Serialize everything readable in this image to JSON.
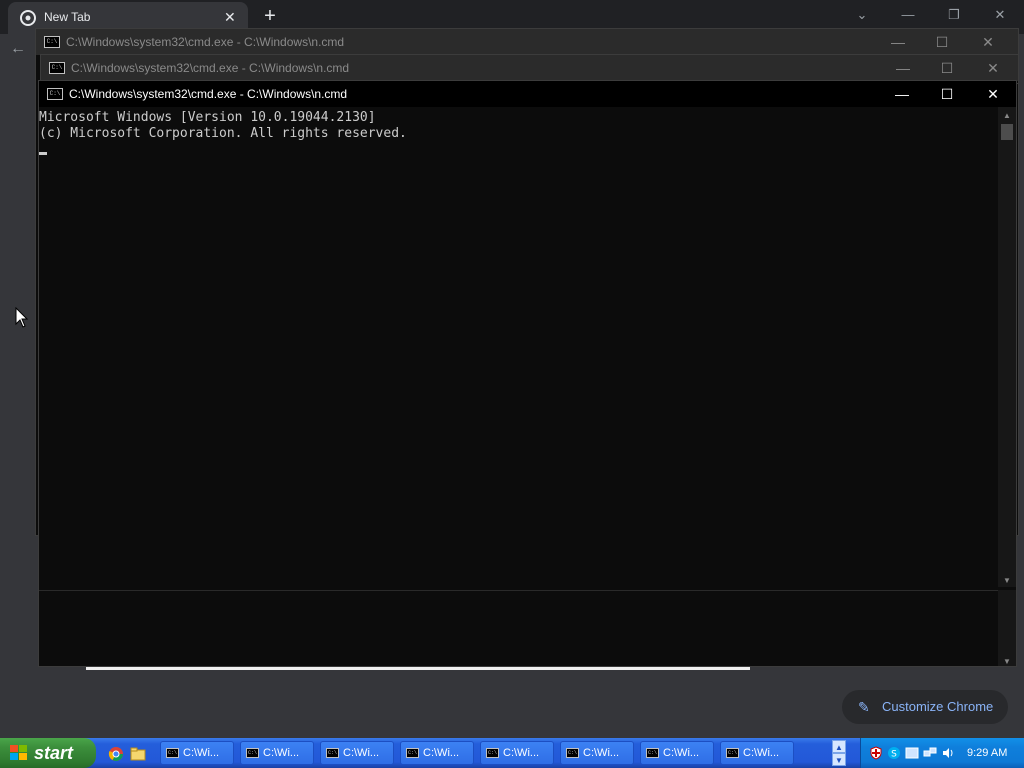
{
  "chrome": {
    "tab_title": "New Tab",
    "tab_close": "✕",
    "new_tab": "+",
    "dropdown_icon": "chevron-down-icon",
    "customize_label": "Customize Chrome"
  },
  "cmd_windows": [
    {
      "title": "C:\\Windows\\system32\\cmd.exe - C:\\Windows\\n.cmd"
    },
    {
      "title": "C:\\Windows\\system32\\cmd.exe - C:\\Windows\\n.cmd"
    },
    {
      "title": "C:\\Windows\\system32\\cmd.exe - C:\\Windows\\n.cmd"
    }
  ],
  "console": {
    "lines": [
      "Microsoft Windows [Version 10.0.19044.2130]",
      "(c) Microsoft Corporation. All rights reserved."
    ]
  },
  "taskbar": {
    "start_label": "start",
    "tasks": [
      {
        "label": "C:\\Wi..."
      },
      {
        "label": "C:\\Wi..."
      },
      {
        "label": "C:\\Wi..."
      },
      {
        "label": "C:\\Wi..."
      },
      {
        "label": "C:\\Wi..."
      },
      {
        "label": "C:\\Wi..."
      },
      {
        "label": "C:\\Wi..."
      },
      {
        "label": "C:\\Wi..."
      }
    ],
    "clock": "9:29 AM"
  },
  "colors": {
    "chrome_bg": "#35363a",
    "console_bg": "#0c0c0c",
    "console_text": "#cccccc",
    "taskbar_blue": "#245edb",
    "start_green": "#3c8f3c",
    "link_blue": "#8ab4f8"
  }
}
